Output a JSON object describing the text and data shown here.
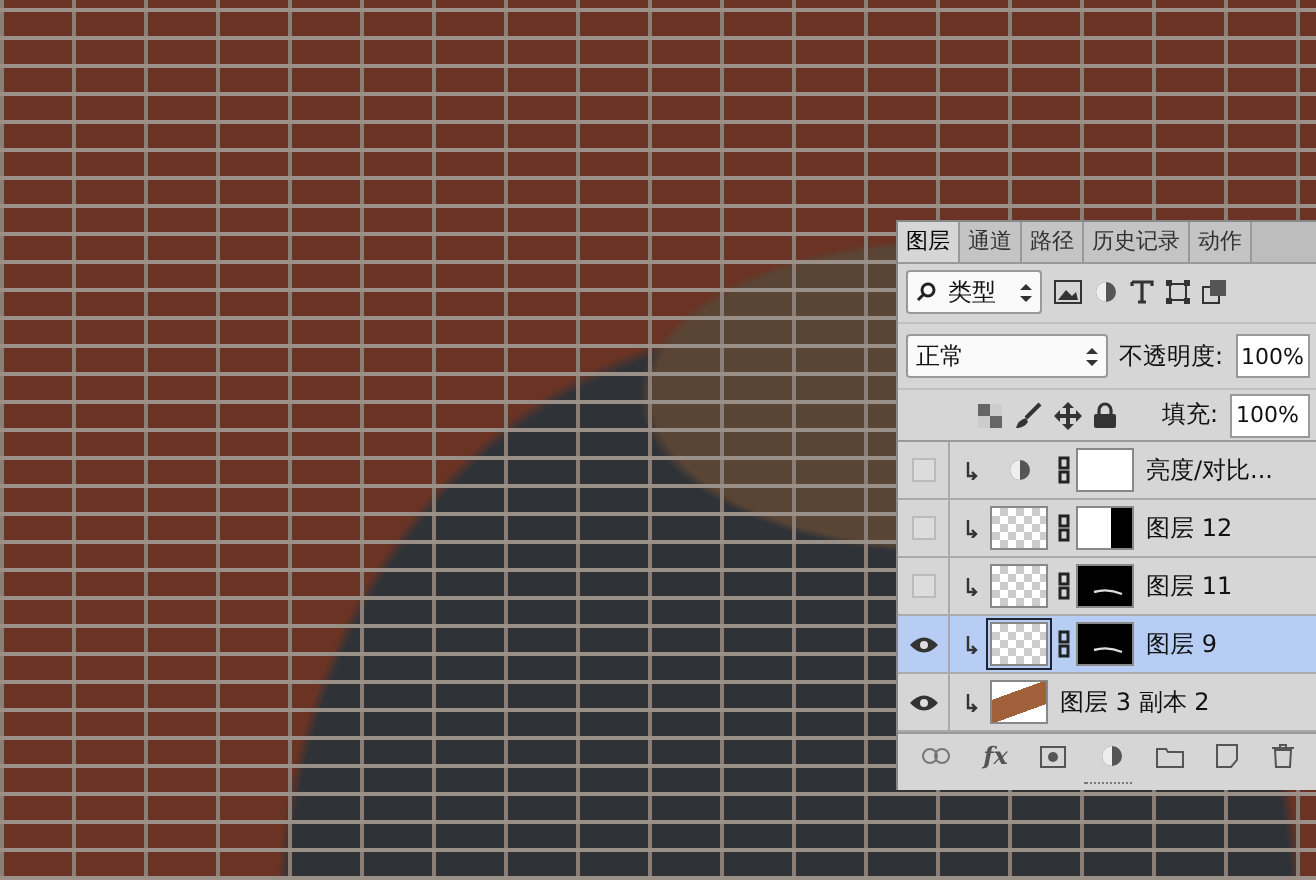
{
  "layers_panel": {
    "tabs": [
      {
        "label": "图层",
        "selected": true
      },
      {
        "label": "通道",
        "selected": false
      },
      {
        "label": "路径",
        "selected": false
      },
      {
        "label": "历史记录",
        "selected": false
      },
      {
        "label": "动作",
        "selected": false
      }
    ],
    "filter": {
      "value": "类型"
    },
    "blend_mode": {
      "value": "正常"
    },
    "opacity": {
      "label": "不透明度:",
      "value": "100%"
    },
    "fill": {
      "label": "填充:",
      "value": "100%"
    },
    "layers": [
      {
        "name": "亮度/对比...",
        "visible": false,
        "selected": false,
        "kind": "adjustment",
        "mask": {
          "kind": "white"
        }
      },
      {
        "name": "图层 12",
        "visible": false,
        "selected": false,
        "kind": "masked",
        "mask": {
          "kind": "split"
        }
      },
      {
        "name": "图层 11",
        "visible": false,
        "selected": false,
        "kind": "masked",
        "mask": {
          "kind": "stroke"
        }
      },
      {
        "name": "图层 9",
        "visible": true,
        "selected": true,
        "kind": "masked",
        "mask": {
          "kind": "stroke"
        }
      },
      {
        "name": "图层 3 副本 2",
        "visible": true,
        "selected": false,
        "kind": "plain"
      }
    ],
    "effects_button": "fx"
  }
}
